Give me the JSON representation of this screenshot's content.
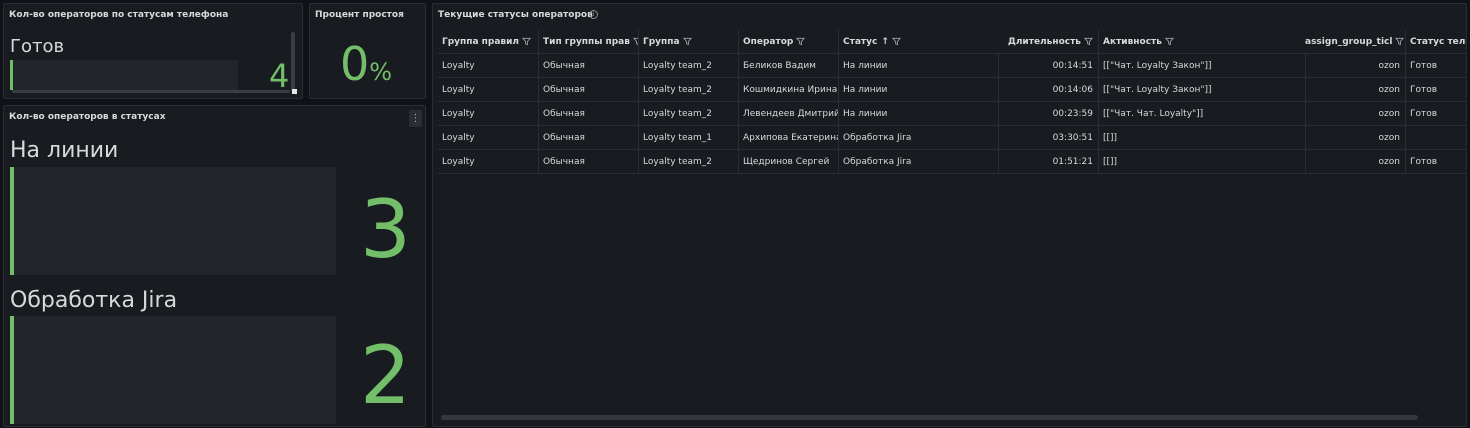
{
  "panel1": {
    "title": "Кол-во операторов по статусам телефона",
    "label": "Готов",
    "value": "4",
    "fill": 0.0
  },
  "panel2": {
    "title": "Процент простоя",
    "value": "0",
    "unit": "%"
  },
  "panel3": {
    "title": "Кол-во операторов в статусах",
    "items": [
      {
        "label": "На линии",
        "value": "3"
      },
      {
        "label": "Обработка Jira",
        "value": "2"
      }
    ],
    "menu_icon": "more-vertical-icon"
  },
  "panel4": {
    "title": "Текущие статусы операторов",
    "info_icon": "info-icon",
    "columns": [
      "Группа правил",
      "Тип группы прав",
      "Группа",
      "Оператор",
      "Статус",
      "Длительность",
      "Активность",
      "assign_group_ticl",
      "Статус теле"
    ],
    "sort_indicator": "↑",
    "rows": [
      [
        "Loyalty",
        "Обычная",
        "Loyalty team_2",
        "Беликов Вадим",
        "На линии",
        "00:14:51",
        "[[\"Чат. Loyalty Закон\"]]",
        "ozon",
        "Готов"
      ],
      [
        "Loyalty",
        "Обычная",
        "Loyalty team_2",
        "Кошмидкина Ирина",
        "На линии",
        "00:14:06",
        "[[\"Чат. Loyalty Закон\"]]",
        "ozon",
        "Готов"
      ],
      [
        "Loyalty",
        "Обычная",
        "Loyalty team_2",
        "Левендеев Дмитрий",
        "На линии",
        "00:23:59",
        "[[\"Чат. Чат. Loyalty\"]]",
        "ozon",
        "Готов"
      ],
      [
        "Loyalty",
        "Обычная",
        "Loyalty team_1",
        "Архипова Екатерина",
        "Обработка Jira",
        "03:30:51",
        "[[]]",
        "ozon",
        ""
      ],
      [
        "Loyalty",
        "Обычная",
        "Loyalty team_2",
        "Щедринов Сергей",
        "Обработка Jira",
        "01:51:21",
        "[[]]",
        "ozon",
        "Готов"
      ]
    ]
  },
  "colors": {
    "background": "#111217",
    "panel": "#181b1f",
    "accent_green": "#73bf69",
    "text": "#d8d9da"
  }
}
